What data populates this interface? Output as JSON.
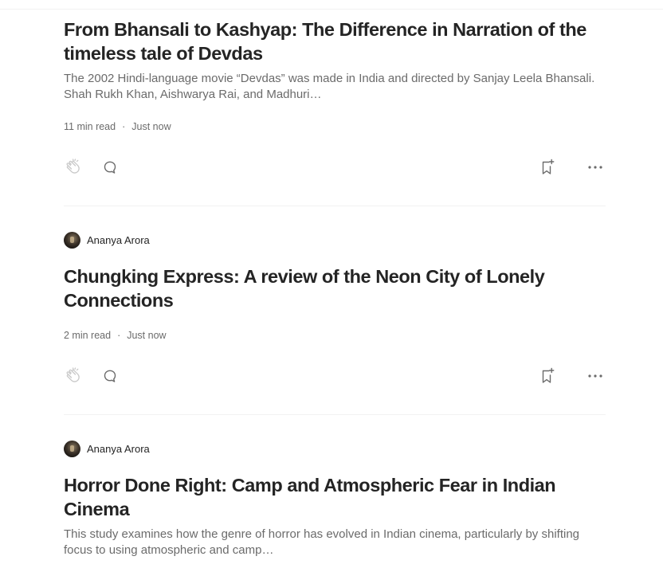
{
  "articles": [
    {
      "title": "From Bhansali to Kashyap: The Difference in Narration of the timeless tale of Devdas",
      "subtitle": "The 2002 Hindi-language movie “Devdas” was made in India and directed by Sanjay Leela Bhansali. Shah Rukh Khan, Aishwarya Rai, and Madhuri…",
      "read_time": "11 min read",
      "separator": "·",
      "published": "Just now"
    },
    {
      "author": "Ananya Arora",
      "title": "Chungking Express: A review of the Neon City of Lonely Connections",
      "read_time": "2 min read",
      "separator": "·",
      "published": "Just now"
    },
    {
      "author": "Ananya Arora",
      "title": "Horror Done Right: Camp and Atmospheric Fear in Indian Cinema",
      "subtitle": "This study examines how the genre of horror has evolved in Indian cinema, particularly by shifting focus to using atmospheric and camp…"
    }
  ],
  "icons": {
    "clap": "clap-icon",
    "response": "response-icon",
    "save": "bookmark-add-icon",
    "more": "more-icon"
  },
  "colors": {
    "text_primary": "#242424",
    "text_secondary": "#6b6b6b",
    "icon": "#6b6b6b",
    "divider": "#f2f2f2"
  }
}
